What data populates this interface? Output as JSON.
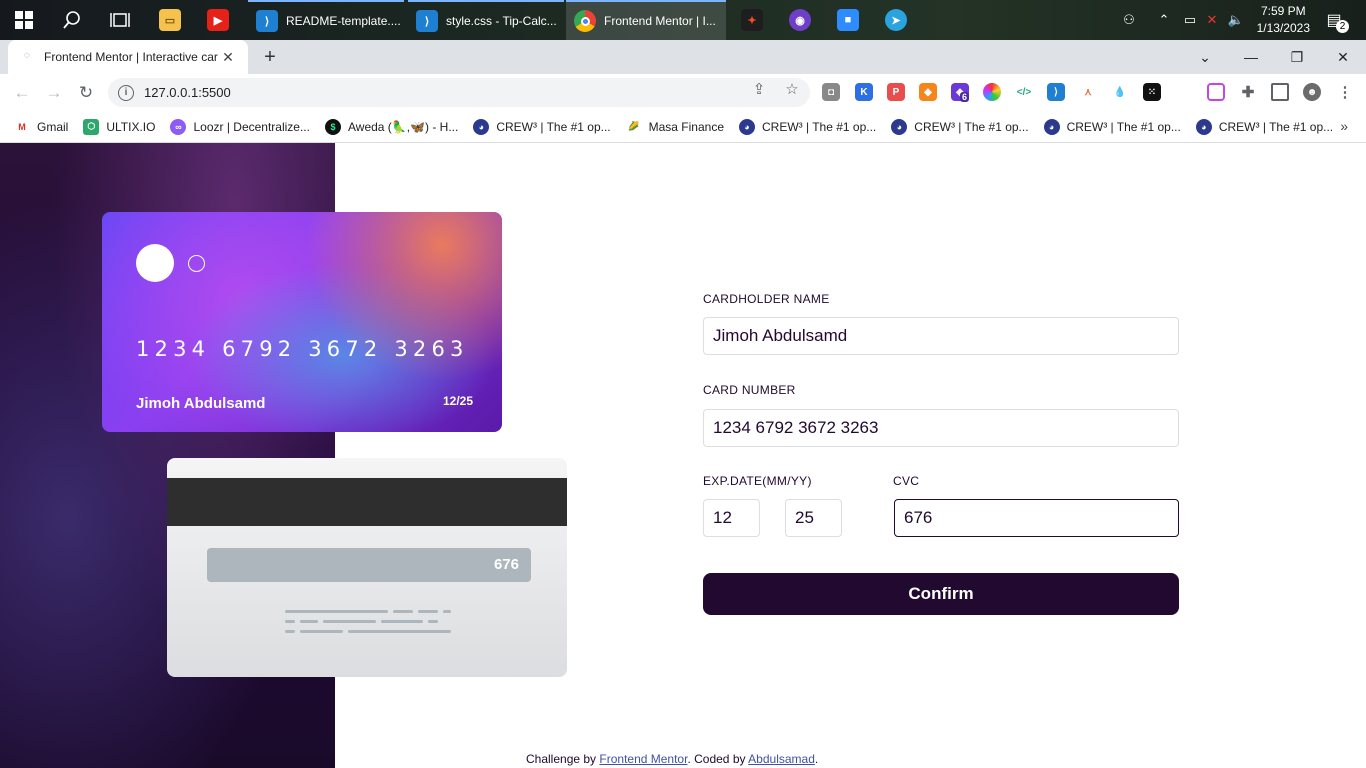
{
  "taskbar": {
    "apps": [
      {
        "label": "README-template...."
      },
      {
        "label": "style.css - Tip-Calc..."
      },
      {
        "label": "Frontend Mentor | I..."
      }
    ],
    "clock": {
      "time": "7:59 PM",
      "date": "1/13/2023"
    },
    "notification_count": "2"
  },
  "browser": {
    "tab_title": "Frontend Mentor | Interactive car",
    "url": "127.0.0.1:5500",
    "bookmarks": [
      {
        "label": "Gmail"
      },
      {
        "label": "ULTIX.IO"
      },
      {
        "label": "Loozr | Decentralize..."
      },
      {
        "label": "Aweda (🦜,🦋) - H..."
      },
      {
        "label": "CREW³ | The #1 op..."
      },
      {
        "label": "Masa Finance"
      },
      {
        "label": "CREW³ | The #1 op..."
      },
      {
        "label": "CREW³ | The #1 op..."
      },
      {
        "label": "CREW³ | The #1 op..."
      },
      {
        "label": "CREW³ | The #1 op..."
      }
    ],
    "extension_badge": "6"
  },
  "card_front": {
    "number": "1234 6792 3672 3263",
    "name": "Jimoh Abdulsamd",
    "expiry": "12/25"
  },
  "card_back": {
    "cvc": "676"
  },
  "form": {
    "name_label": "CARDHOLDER NAME",
    "name_value": "Jimoh Abdulsamd",
    "number_label": "CARD NUMBER",
    "number_value": "1234 6792 3672 3263",
    "exp_label": "EXP.DATE(MM/YY)",
    "exp_month": "12",
    "exp_year": "25",
    "cvc_label": "CVC",
    "cvc_value": "676",
    "confirm_label": "Confirm"
  },
  "footer": {
    "prefix": "Challenge by ",
    "link1": "Frontend Mentor",
    "middle": ". Coded by ",
    "link2": "Abdulsamad",
    "suffix": "."
  }
}
